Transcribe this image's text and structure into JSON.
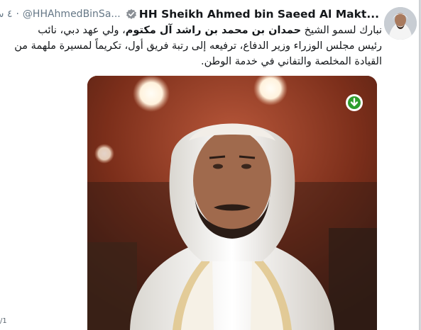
{
  "tweet": {
    "display_name": "HH Sheikh Ahmed bin Saeed Al Makt...",
    "handle": "@HHAhmedBinSa...",
    "separator": "·",
    "time": "٤ س",
    "text_part1": "نبارك لسمو الشيخ ",
    "text_bold": "حمدان بن محمد بن راشد آل مكتوم",
    "text_part2": "، ولي عهد دبي، نائب رئيس مجلس الوزراء وزير الدفاع، ترفيعه إلى رتبة فريق أول، تكريماً لمسيرة ملهمة من القيادة المخلصة والتفاني في خدمة الوطن.",
    "verified_color": "#8a8f95"
  },
  "side": {
    "edge_label": "/1"
  },
  "colors": {
    "download_green": "#2e9e2e",
    "bg_warm": "#6f2d1a"
  }
}
